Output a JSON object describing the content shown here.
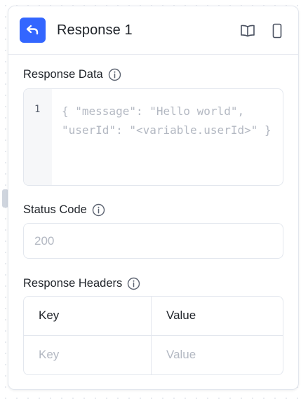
{
  "header": {
    "title": "Response 1",
    "node_icon": "reply-arrow-icon",
    "actions": [
      "book-open-icon",
      "mobile-phone-icon"
    ]
  },
  "response_data": {
    "label": "Response Data",
    "line_number": "1",
    "code_line1": "{ \"message\": \"Hello world\",",
    "code_line2": "\"userId\": \"<variable.userId>\" }"
  },
  "status_code": {
    "label": "Status Code",
    "placeholder": "200"
  },
  "response_headers": {
    "label": "Response Headers",
    "columns": [
      "Key",
      "Value"
    ],
    "row_placeholders": [
      "Key",
      "Value"
    ]
  },
  "colors": {
    "accent": "#3366ff",
    "placeholder": "#b3b8c2",
    "text": "#1f2329",
    "border": "#e3e7ee"
  }
}
